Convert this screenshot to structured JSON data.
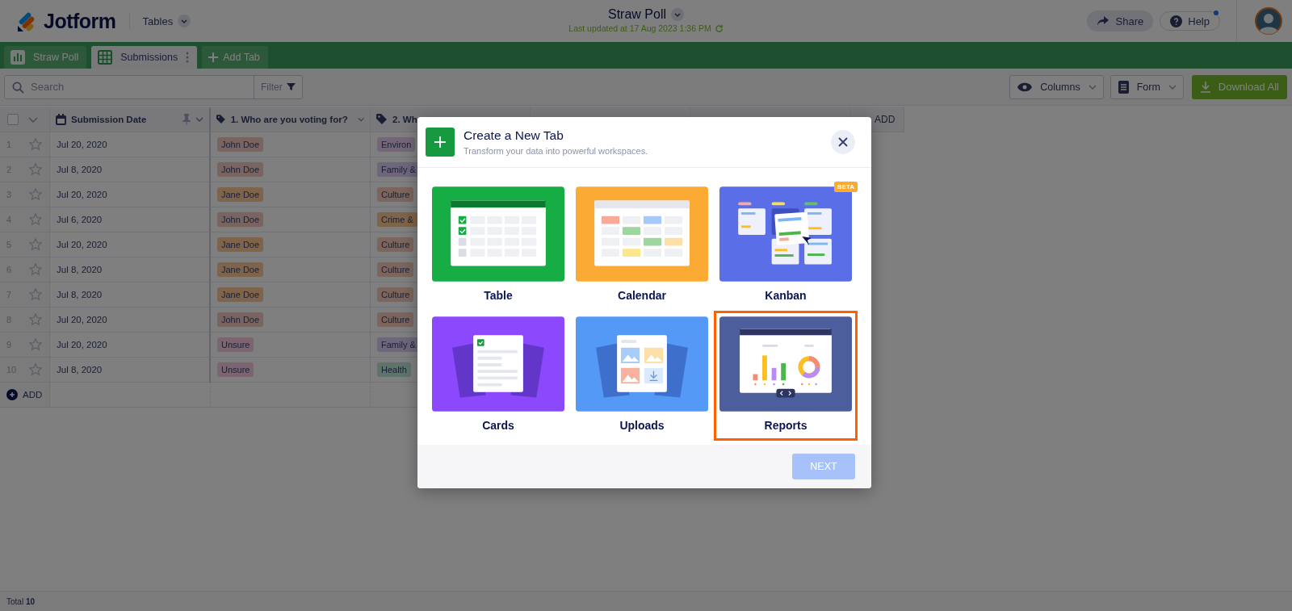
{
  "header": {
    "logo": "Jotform",
    "workspace": "Tables",
    "title": "Straw Poll",
    "last_updated": "Last updated at 17 Aug 2023 1:36 PM",
    "share": "Share",
    "help": "Help",
    "help_notification": true
  },
  "tabs": [
    {
      "label": "Straw Poll",
      "kind": "report",
      "selected": false
    },
    {
      "label": "Submissions",
      "kind": "table",
      "selected": true
    }
  ],
  "add_tab": "Add Tab",
  "toolbar": {
    "search_placeholder": "Search",
    "filter": "Filter",
    "columns": "Columns",
    "form": "Form",
    "download": "Download All"
  },
  "table": {
    "columns": [
      {
        "label": "Submission Date",
        "kind": "date",
        "pinned": true
      },
      {
        "label": "1. Who are you voting for?",
        "kind": "tag",
        "pinned": false
      },
      {
        "label": "2. Wh",
        "kind": "tag",
        "pinned": false
      }
    ],
    "add_column": "ADD",
    "select_all_checked": false,
    "rows": [
      {
        "number": "1",
        "starred": false,
        "cells": [
          {
            "text": "Jul 20, 2020"
          },
          {
            "text": "John Doe",
            "color": "#7a645f"
          },
          {
            "text": "Environ",
            "color": "#736678"
          }
        ]
      },
      {
        "number": "2",
        "starred": false,
        "cells": [
          {
            "text": "Jul 8, 2020"
          },
          {
            "text": "John Doe",
            "color": "#7a645f"
          },
          {
            "text": "Family &",
            "color": "#6e667b"
          }
        ]
      },
      {
        "number": "3",
        "starred": false,
        "cells": [
          {
            "text": "Jul 20, 2020"
          },
          {
            "text": "Jane Doe",
            "color": "#7e644b"
          },
          {
            "text": "Culture",
            "color": "#7b655c"
          }
        ]
      },
      {
        "number": "4",
        "starred": false,
        "cells": [
          {
            "text": "Jul 6, 2020"
          },
          {
            "text": "John Doe",
            "color": "#7a645f"
          },
          {
            "text": "Crime &",
            "color": "#7e6448"
          }
        ]
      },
      {
        "number": "5",
        "starred": false,
        "cells": [
          {
            "text": "Jul 20, 2020"
          },
          {
            "text": "Jane Doe",
            "color": "#7e644b"
          },
          {
            "text": "Culture",
            "color": "#7b655c"
          }
        ]
      },
      {
        "number": "6",
        "starred": false,
        "cells": [
          {
            "text": "Jul 8, 2020"
          },
          {
            "text": "Jane Doe",
            "color": "#7e644b"
          },
          {
            "text": "Culture",
            "color": "#7b655c"
          }
        ]
      },
      {
        "number": "7",
        "starred": false,
        "cells": [
          {
            "text": "Jul 8, 2020"
          },
          {
            "text": "Jane Doe",
            "color": "#7e644b"
          },
          {
            "text": "Culture",
            "color": "#7b655c"
          }
        ]
      },
      {
        "number": "8",
        "starred": false,
        "cells": [
          {
            "text": "Jul 20, 2020"
          },
          {
            "text": "John Doe",
            "color": "#7a645f"
          },
          {
            "text": "Culture",
            "color": "#7b655c"
          }
        ]
      },
      {
        "number": "9",
        "starred": false,
        "cells": [
          {
            "text": "Jul 20, 2020"
          },
          {
            "text": "Unsure",
            "color": "#7c6470"
          },
          {
            "text": "Family &",
            "color": "#6e667b"
          }
        ]
      },
      {
        "number": "10",
        "starred": false,
        "cells": [
          {
            "text": "Jul 8, 2020"
          },
          {
            "text": "Unsure",
            "color": "#7c6470"
          },
          {
            "text": "Health",
            "color": "#5e746b"
          }
        ]
      }
    ],
    "add_row": "ADD"
  },
  "status_bar": {
    "total": "Total **10**"
  },
  "modal": {
    "title": "Create a New Tab",
    "subtitle": "Transform your data into powerful workspaces.",
    "options": [
      {
        "label": "Table",
        "kind": "table",
        "selected": false
      },
      {
        "label": "Calendar",
        "kind": "calendar",
        "selected": false
      },
      {
        "label": "Kanban",
        "kind": "kanban",
        "selected": false,
        "badge": "BETA"
      },
      {
        "label": "Cards",
        "kind": "cards",
        "selected": false
      },
      {
        "label": "Uploads",
        "kind": "uploads",
        "selected": false
      },
      {
        "label": "Reports",
        "kind": "reports",
        "selected": true
      }
    ],
    "next": {
      "label": "NEXT",
      "disabled": true
    }
  }
}
